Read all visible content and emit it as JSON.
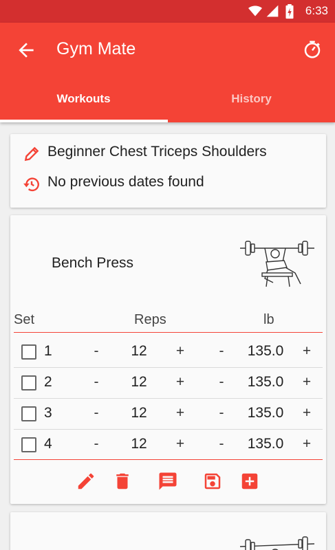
{
  "status_bar": {
    "time": "6:33"
  },
  "appbar": {
    "title": "Gym Mate"
  },
  "tabs": [
    {
      "label": "Workouts",
      "active": true
    },
    {
      "label": "History",
      "active": false
    }
  ],
  "workout": {
    "name": "Beginner Chest Triceps Shoulders",
    "history_note": "No previous dates found"
  },
  "exercise": {
    "name": "Bench Press",
    "columns": {
      "set": "Set",
      "reps": "Reps",
      "weight": "lb"
    },
    "stepper": {
      "minus": "-",
      "plus": "+"
    },
    "sets": [
      {
        "set": "1",
        "reps": "12",
        "weight": "135.0",
        "done": false
      },
      {
        "set": "2",
        "reps": "12",
        "weight": "135.0",
        "done": false
      },
      {
        "set": "3",
        "reps": "12",
        "weight": "135.0",
        "done": false
      },
      {
        "set": "4",
        "reps": "12",
        "weight": "135.0",
        "done": false
      }
    ],
    "actions": [
      "edit-icon",
      "delete-icon",
      "comment-icon",
      "save-icon",
      "add-set-icon"
    ]
  },
  "colors": {
    "accent": "#f44336",
    "status_bar": "#d32f2f"
  }
}
